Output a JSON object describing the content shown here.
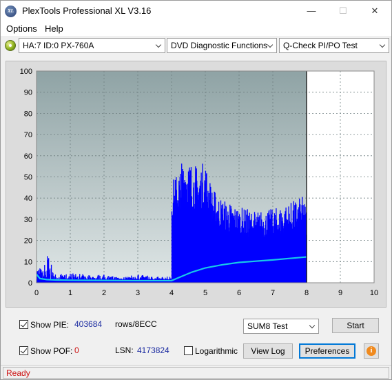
{
  "window": {
    "title": "PlexTools Professional XL V3.16",
    "app_icon_text": "XL",
    "minimize_glyph": "—",
    "maximize_glyph": "☐",
    "close_glyph": "✕"
  },
  "menu": {
    "items": [
      "Options",
      "Help"
    ]
  },
  "toolbar": {
    "drive": "HA:7 ID:0  PX-760A",
    "function": "DVD Diagnostic Functions",
    "test": "Q-Check PI/PO Test"
  },
  "chart_data": {
    "type": "bar",
    "xlim": [
      0,
      10
    ],
    "ylim": [
      0,
      100
    ],
    "xticks": [
      "0",
      "1",
      "2",
      "3",
      "4",
      "5",
      "6",
      "7",
      "8",
      "9",
      "10"
    ],
    "yticks": [
      "0",
      "10",
      "20",
      "30",
      "40",
      "50",
      "60",
      "70",
      "80",
      "90",
      "100"
    ],
    "grid": true,
    "end_marker_x": 8.0,
    "colors": {
      "bars": "#0000ff",
      "line": "#17c9e8",
      "plot_bg_top": "#8fa3a5",
      "plot_bg_bottom": "#dfe6e6",
      "empty_region": "#ffffff"
    },
    "series": [
      {
        "kind": "bars",
        "x": [
          0.0,
          0.1,
          0.2,
          0.3,
          0.5,
          0.8,
          1.0,
          1.5,
          2.0,
          2.5,
          3.0,
          3.5,
          3.9,
          4.0,
          4.2,
          4.4,
          4.6,
          4.8,
          5.0,
          5.2,
          5.5,
          6.0,
          6.5,
          7.0,
          7.5,
          7.9,
          8.0
        ],
        "values": [
          11,
          8,
          6,
          17,
          5,
          4,
          5,
          4,
          4,
          3,
          4,
          3,
          3,
          48,
          53,
          62,
          57,
          55,
          58,
          45,
          40,
          36,
          34,
          35,
          38,
          41,
          36
        ]
      },
      {
        "kind": "line",
        "x": [
          0.0,
          0.1,
          0.3,
          0.6,
          1.0,
          2.0,
          3.0,
          4.0,
          4.3,
          4.6,
          5.0,
          5.5,
          6.0,
          6.5,
          7.0,
          7.5,
          8.0
        ],
        "values": [
          4,
          2,
          1.5,
          1.3,
          1.2,
          1.1,
          1.0,
          1.0,
          3,
          5,
          7,
          8.5,
          9.6,
          10.2,
          10.8,
          11.5,
          12.2
        ]
      }
    ]
  },
  "controls": {
    "show_pie_label": "Show PIE:",
    "pie_value": "403684",
    "rows_label": "rows/8ECC",
    "show_pof_label": "Show POF:",
    "pof_value": "0",
    "lsn_label": "LSN:",
    "lsn_value": "4173824",
    "logarithmic_label": "Logarithmic",
    "test_mode": "SUM8 Test",
    "start_label": "Start",
    "view_log_label": "View Log",
    "preferences_label": "Preferences",
    "info_glyph": "i",
    "show_pie_checked": true,
    "show_pof_checked": true,
    "logarithmic_checked": false
  },
  "status": {
    "text": "Ready"
  }
}
